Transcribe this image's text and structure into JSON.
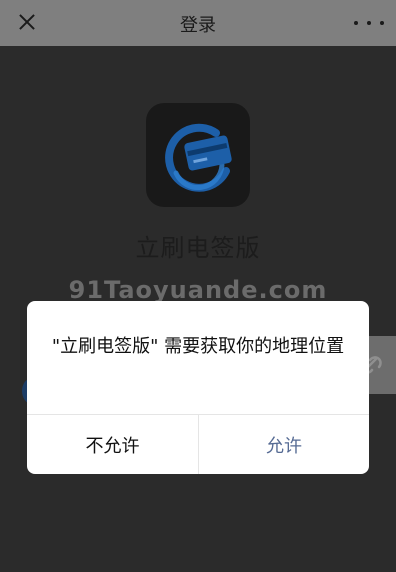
{
  "header": {
    "title": "登录"
  },
  "app": {
    "name": "立刷电签版",
    "icon": "card-payment-logo",
    "brand_color": "#1d5fa8"
  },
  "watermark": {
    "text": "91Taoyuande.com"
  },
  "dialog": {
    "message": "\"立刷电签版\" 需要获取你的地理位置",
    "deny_label": "不允许",
    "allow_label": "允许",
    "allow_color": "#566b94"
  }
}
